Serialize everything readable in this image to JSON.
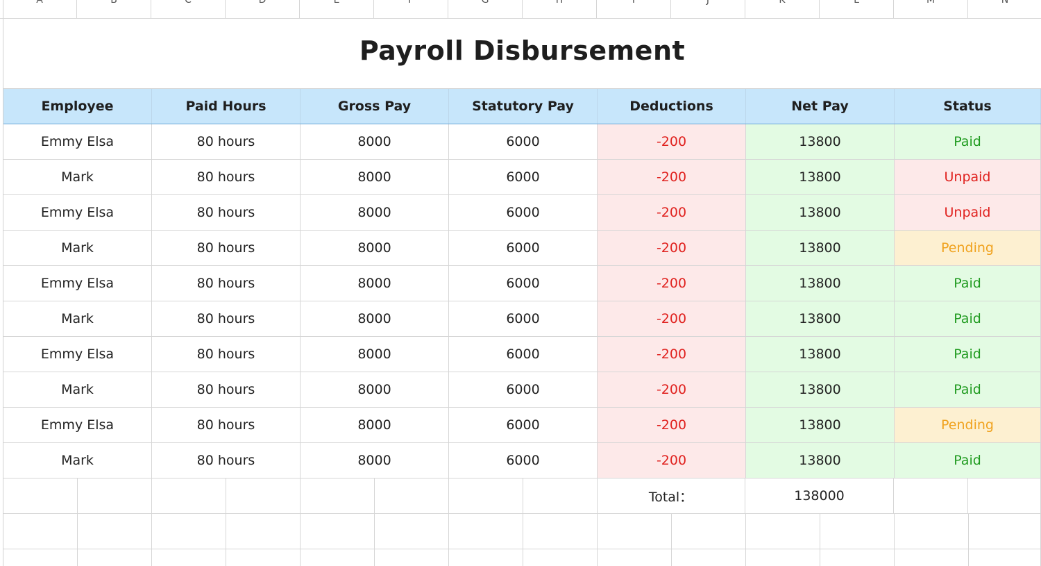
{
  "sheet": {
    "columns": [
      "A",
      "B",
      "C",
      "D",
      "E",
      "F",
      "G",
      "H",
      "I",
      "J",
      "K",
      "L",
      "M",
      "N"
    ],
    "title": "Payroll  Disbursement"
  },
  "table": {
    "headers": [
      "Employee",
      "Paid Hours",
      "Gross Pay",
      "Statutory Pay",
      "Deductions",
      "Net Pay",
      "Status"
    ],
    "rows": [
      {
        "employee": "Emmy Elsa",
        "hours": "80 hours",
        "gross": "8000",
        "statutory": "6000",
        "deductions": "-200",
        "net": "13800",
        "status": "Paid"
      },
      {
        "employee": "Mark",
        "hours": "80 hours",
        "gross": "8000",
        "statutory": "6000",
        "deductions": "-200",
        "net": "13800",
        "status": "Unpaid"
      },
      {
        "employee": "Emmy Elsa",
        "hours": "80 hours",
        "gross": "8000",
        "statutory": "6000",
        "deductions": "-200",
        "net": "13800",
        "status": "Unpaid"
      },
      {
        "employee": "Mark",
        "hours": "80 hours",
        "gross": "8000",
        "statutory": "6000",
        "deductions": "-200",
        "net": "13800",
        "status": "Pending"
      },
      {
        "employee": "Emmy Elsa",
        "hours": "80 hours",
        "gross": "8000",
        "statutory": "6000",
        "deductions": "-200",
        "net": "13800",
        "status": "Paid"
      },
      {
        "employee": "Mark",
        "hours": "80 hours",
        "gross": "8000",
        "statutory": "6000",
        "deductions": "-200",
        "net": "13800",
        "status": "Paid"
      },
      {
        "employee": "Emmy Elsa",
        "hours": "80 hours",
        "gross": "8000",
        "statutory": "6000",
        "deductions": "-200",
        "net": "13800",
        "status": "Paid"
      },
      {
        "employee": "Mark",
        "hours": "80 hours",
        "gross": "8000",
        "statutory": "6000",
        "deductions": "-200",
        "net": "13800",
        "status": "Paid"
      },
      {
        "employee": "Emmy Elsa",
        "hours": "80 hours",
        "gross": "8000",
        "statutory": "6000",
        "deductions": "-200",
        "net": "13800",
        "status": "Pending"
      },
      {
        "employee": "Mark",
        "hours": "80 hours",
        "gross": "8000",
        "statutory": "6000",
        "deductions": "-200",
        "net": "13800",
        "status": "Paid"
      }
    ],
    "total_label": "Total：",
    "total_value": "138000"
  },
  "colors": {
    "header_bg": "#c7e6fb",
    "deduction_bg": "#fde9e9",
    "deduction_text": "#e0211e",
    "net_bg": "#e3fbe3",
    "paid_text": "#1e9a1e",
    "unpaid_text": "#e0211e",
    "pending_text": "#f0a21e",
    "pending_bg": "#fdf0d1"
  }
}
